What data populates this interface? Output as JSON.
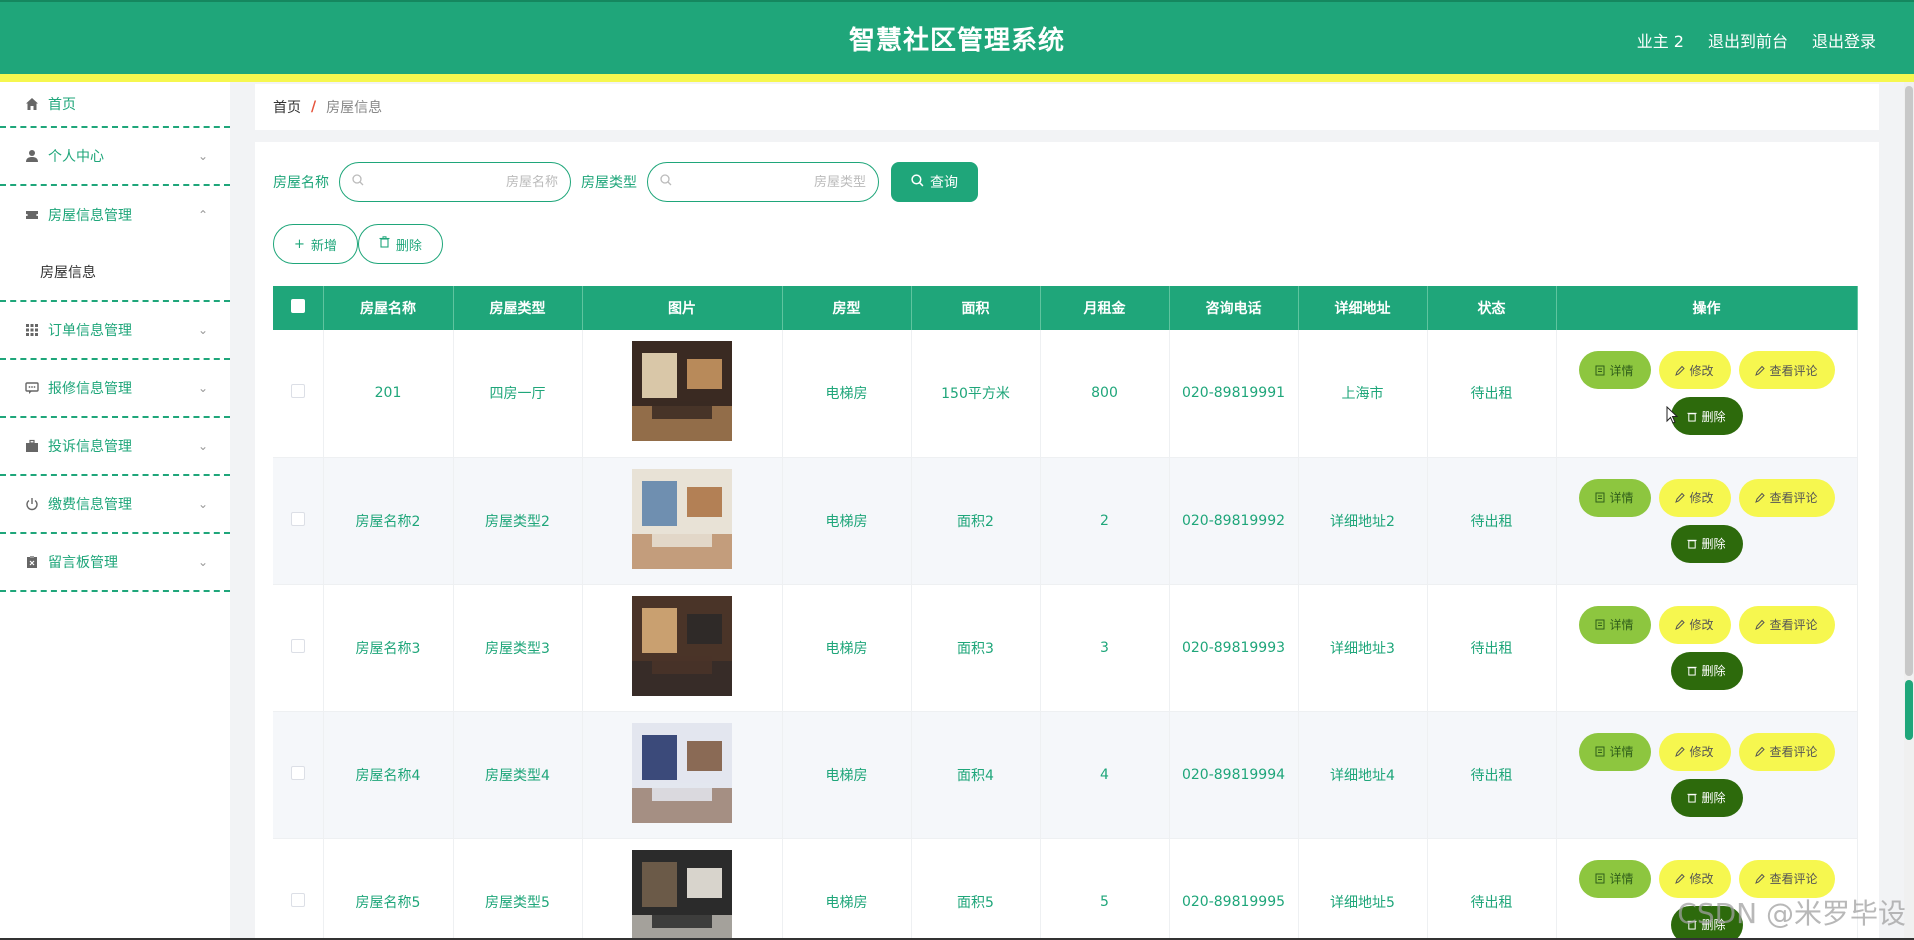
{
  "header": {
    "title": "智慧社区管理系统",
    "user": "业主 2",
    "to_front": "退出到前台",
    "logout": "退出登录"
  },
  "sidebar": {
    "items": [
      {
        "label": "首页",
        "icon": "home-icon"
      },
      {
        "label": "个人中心",
        "icon": "user-icon"
      },
      {
        "label": "房屋信息管理",
        "icon": "ticket-icon",
        "expanded": true,
        "children": [
          "房屋信息"
        ]
      },
      {
        "label": "订单信息管理",
        "icon": "grid-icon"
      },
      {
        "label": "报修信息管理",
        "icon": "chat-icon"
      },
      {
        "label": "投诉信息管理",
        "icon": "briefcase-icon"
      },
      {
        "label": "缴费信息管理",
        "icon": "power-icon"
      },
      {
        "label": "留言板管理",
        "icon": "clipboard-icon"
      }
    ]
  },
  "breadcrumb": {
    "home": "首页",
    "separator": "/",
    "current": "房屋信息"
  },
  "search": {
    "name_label": "房屋名称",
    "name_placeholder": "房屋名称",
    "type_label": "房屋类型",
    "type_placeholder": "房屋类型",
    "query_label": "查询"
  },
  "actions": {
    "add_label": "新增",
    "delete_label": "删除"
  },
  "table": {
    "columns": [
      "房屋名称",
      "房屋类型",
      "图片",
      "房型",
      "面积",
      "月租金",
      "咨询电话",
      "详细地址",
      "状态",
      "操作"
    ],
    "rows": [
      {
        "name": "201",
        "type": "四房一厅",
        "layout": "电梯房",
        "area": "150平方米",
        "rent": "800",
        "phone": "020-89819991",
        "address": "上海市",
        "status": "待出租"
      },
      {
        "name": "房屋名称2",
        "type": "房屋类型2",
        "layout": "电梯房",
        "area": "面积2",
        "rent": "2",
        "phone": "020-89819992",
        "address": "详细地址2",
        "status": "待出租"
      },
      {
        "name": "房屋名称3",
        "type": "房屋类型3",
        "layout": "电梯房",
        "area": "面积3",
        "rent": "3",
        "phone": "020-89819993",
        "address": "详细地址3",
        "status": "待出租"
      },
      {
        "name": "房屋名称4",
        "type": "房屋类型4",
        "layout": "电梯房",
        "area": "面积4",
        "rent": "4",
        "phone": "020-89819994",
        "address": "详细地址4",
        "status": "待出租"
      },
      {
        "name": "房屋名称5",
        "type": "房屋类型5",
        "layout": "电梯房",
        "area": "面积5",
        "rent": "5",
        "phone": "020-89819995",
        "address": "详细地址5",
        "status": "待出租"
      }
    ],
    "ops": {
      "detail": "详情",
      "edit": "修改",
      "review": "查看评论",
      "delete": "删除"
    }
  },
  "watermark": "CSDN @米罗毕设",
  "colors": {
    "primary": "#1fa67a",
    "stripe": "#f6f74f",
    "detail_btn": "#8dc63f",
    "delete_btn": "#2d6a0c"
  }
}
